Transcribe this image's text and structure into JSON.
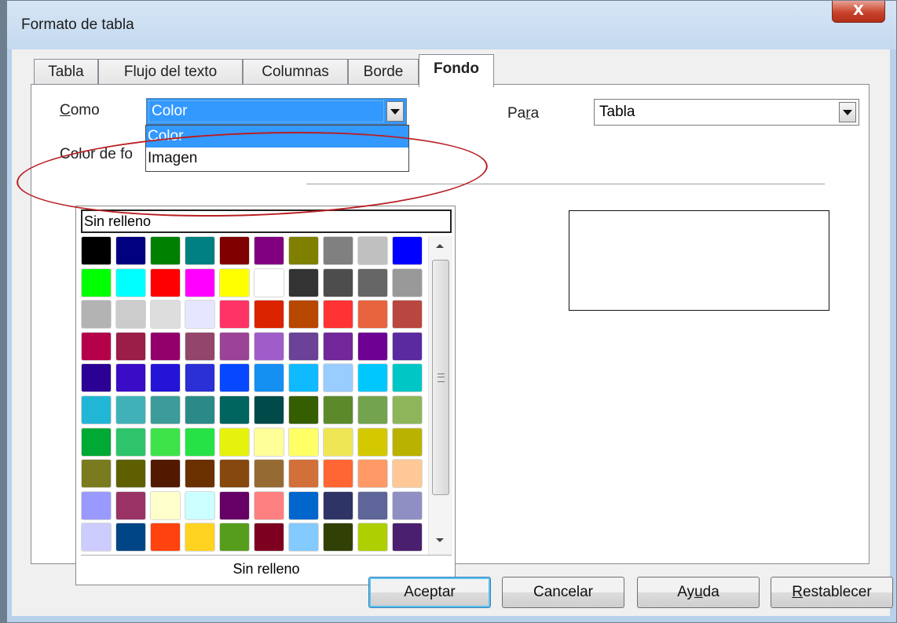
{
  "window": {
    "title": "Formato de tabla",
    "close_glyph": "X"
  },
  "tabs": [
    {
      "label": "Tabla",
      "active": false
    },
    {
      "label": "Flujo del texto",
      "active": false
    },
    {
      "label": "Columnas",
      "active": false
    },
    {
      "label": "Borde",
      "active": false
    },
    {
      "label": "Fondo",
      "active": true
    }
  ],
  "como": {
    "label_first": "C",
    "label_rest": "omo",
    "value": "Color",
    "options": [
      "Color",
      "Imagen"
    ],
    "selected_index": 0
  },
  "para": {
    "label_pre": "Pa",
    "label_mnemonic": "r",
    "label_post": "a",
    "value": "Tabla"
  },
  "color_section": {
    "label": "Color de fo"
  },
  "palette": {
    "none_label": "Sin relleno",
    "footer_label": "Sin relleno",
    "colors": [
      [
        "#000000",
        "#000080",
        "#008000",
        "#008080",
        "#800000",
        "#800080",
        "#808000",
        "#808080",
        "#c0c0c0",
        "#0000ff"
      ],
      [
        "#00ff00",
        "#00ffff",
        "#ff0000",
        "#ff00ff",
        "#ffff00",
        "#ffffff",
        "#333333",
        "#4d4d4d",
        "#666666",
        "#999999"
      ],
      [
        "#b3b3b3",
        "#cccccc",
        "#dddddd",
        "#e6e6ff",
        "#ff3366",
        "#dc2300",
        "#b84700",
        "#ff3333",
        "#e8643e",
        "#b9473f"
      ],
      [
        "#b5004a",
        "#9a1e48",
        "#94006b",
        "#94456b",
        "#9b4497",
        "#a05dc9",
        "#6b4298",
        "#72279b",
        "#6f0094",
        "#5b2aa0"
      ],
      [
        "#2b0094",
        "#3b0cc6",
        "#2314d8",
        "#2a2fd6",
        "#0548ff",
        "#148ff2",
        "#0fbaff",
        "#99ccff",
        "#00c8ff",
        "#00c6c6"
      ],
      [
        "#21b6d6",
        "#41b1b8",
        "#3b9c9b",
        "#2a8a88",
        "#00655f",
        "#004a4a",
        "#355e00",
        "#5c8a2a",
        "#73a34e",
        "#8db65a"
      ],
      [
        "#00a933",
        "#2ec46b",
        "#3ee34a",
        "#26e246",
        "#e5f20c",
        "#ffff99",
        "#ffff66",
        "#eee655",
        "#d4c900",
        "#b9b200"
      ],
      [
        "#7a7b1e",
        "#5e6000",
        "#531900",
        "#6b3000",
        "#86480f",
        "#966b33",
        "#d2703a",
        "#ff6633",
        "#ff9966",
        "#ffc896"
      ],
      [
        "#9999ff",
        "#993366",
        "#ffffcc",
        "#ccffff",
        "#660066",
        "#ff8080",
        "#0066cc",
        "#2e3465",
        "#5d6599",
        "#8f8fc4"
      ],
      [
        "#ccccff",
        "#004586",
        "#ff420e",
        "#ffd320",
        "#579d1c",
        "#7e0021",
        "#83caff",
        "#314004",
        "#aecf00",
        "#4b1f6f"
      ]
    ]
  },
  "buttons": {
    "ok": "Aceptar",
    "cancel": "Cancelar",
    "help_pre": "Ay",
    "help_mnemonic": "u",
    "help_post": "da",
    "reset_mnemonic": "R",
    "reset_post": "establecer"
  },
  "colors": {
    "annotation_ellipse": "#b81e22",
    "selection": "#3399ff"
  }
}
